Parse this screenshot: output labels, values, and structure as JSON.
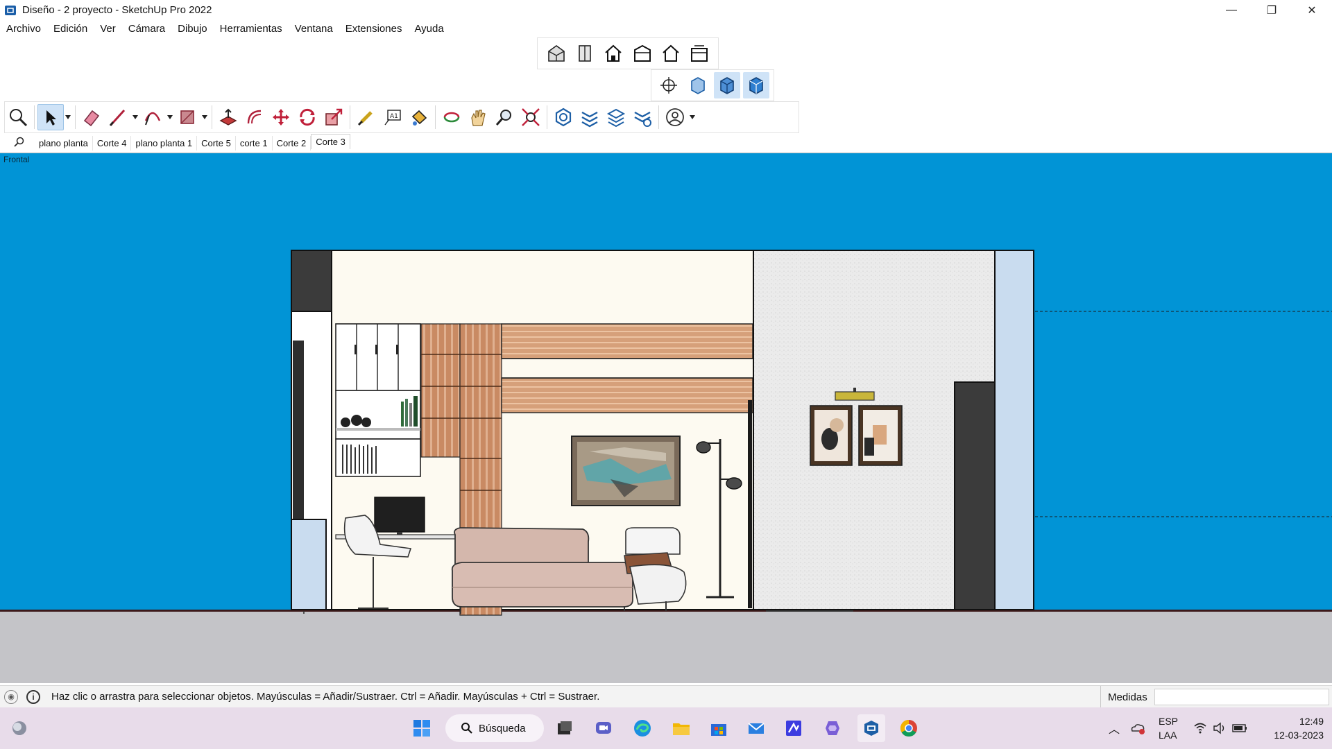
{
  "window": {
    "title": "Diseño - 2 proyecto - SketchUp Pro 2022",
    "minimize": "—",
    "restore": "❐",
    "close": "✕"
  },
  "menu": [
    "Archivo",
    "Edición",
    "Ver",
    "Cámara",
    "Dibujo",
    "Herramientas",
    "Ventana",
    "Extensiones",
    "Ayuda"
  ],
  "toolbars": {
    "views": [
      "iso-view-icon",
      "top-view-icon",
      "front-view-icon",
      "right-view-icon",
      "back-view-icon",
      "left-view-icon"
    ],
    "styles": [
      "xray-style-icon",
      "hidden-line-style-icon",
      "shaded-style-icon",
      "shaded-textures-style-icon"
    ],
    "main_tools": [
      "zoom-extents-icon",
      "select-icon",
      "eraser-icon",
      "line-icon",
      "arc-icon",
      "rectangle-icon",
      "push-pull-icon",
      "offset-icon",
      "move-icon",
      "rotate-icon",
      "scale-icon",
      "tape-measure-icon",
      "text-icon",
      "paint-bucket-icon",
      "orbit-icon",
      "pan-icon",
      "zoom-icon",
      "zoom-window-icon",
      "warehouse-icon",
      "extension-warehouse-icon",
      "layout-icon",
      "extension-manager-icon",
      "account-icon"
    ]
  },
  "scenes": {
    "search_icon": "search-icon",
    "tabs": [
      "plano planta",
      "Corte 4",
      "plano planta 1",
      "Corte 5",
      "corte 1",
      "Corte 2",
      "Corte 3"
    ],
    "active": "Corte 3"
  },
  "viewport": {
    "view_label": "Frontal",
    "sky_color": "#0194d6",
    "ground_color": "#c4c4c8"
  },
  "status": {
    "message": "Haz clic o arrastra para seleccionar objetos. Mayúsculas = Añadir/Sustraer. Ctrl = Añadir. Mayúsculas + Ctrl = Sustraer.",
    "measurements_label": "Medidas",
    "measurements_value": ""
  },
  "taskbar": {
    "search_label": "Búsqueda",
    "language": "ESP",
    "keyboard": "LAA",
    "time": "12:49",
    "date": "12-03-2023"
  }
}
